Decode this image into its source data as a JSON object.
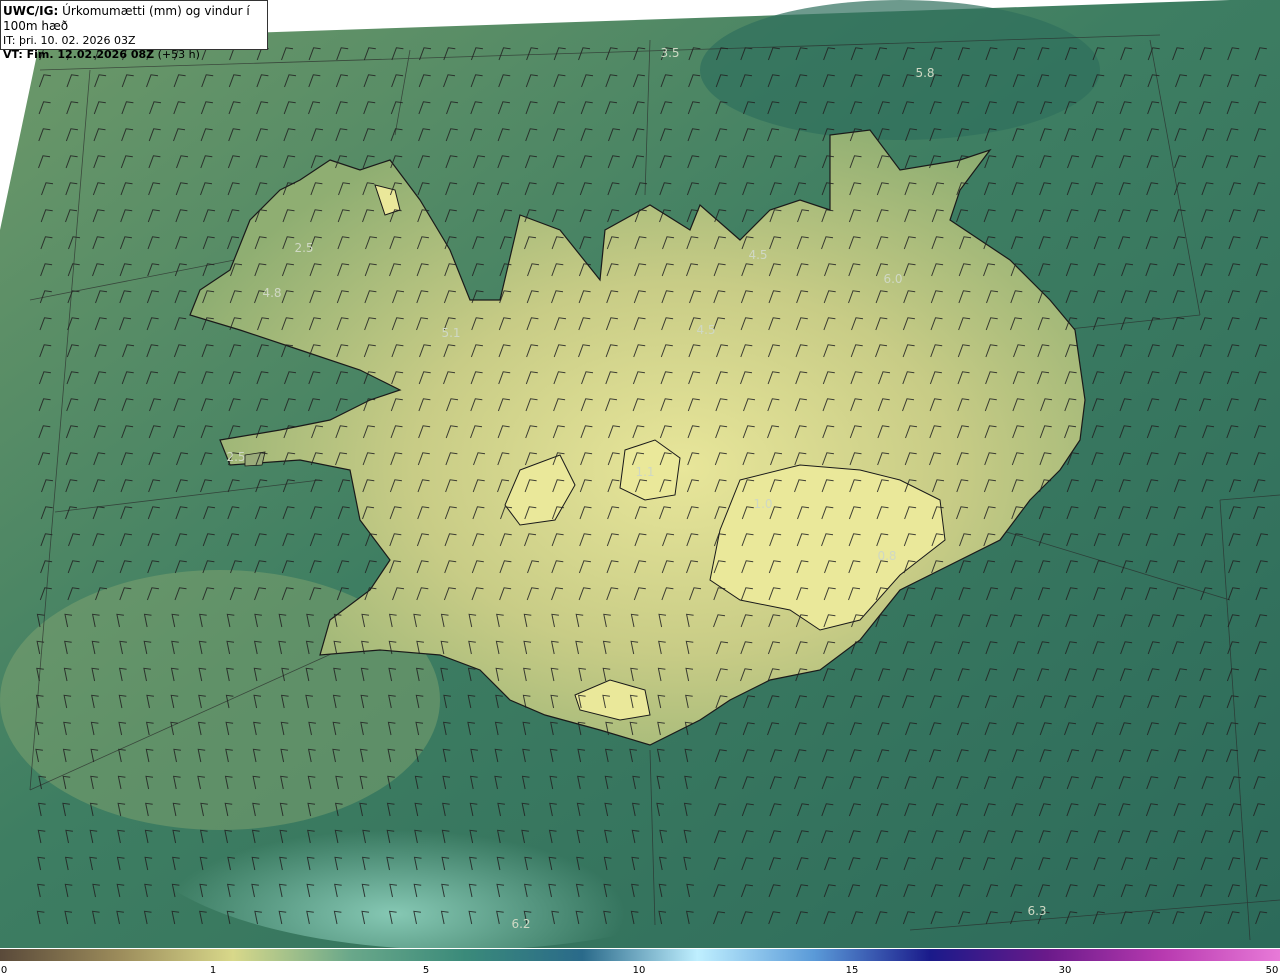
{
  "title": {
    "model": "UWC/IG:",
    "description": "Úrkomumætti (mm) og vindur í 100m hæð",
    "issue_time": "IT: þri. 10. 02. 2026 03Z",
    "valid_prefix": "VT: Fim. 12.02.2026 08Z",
    "valid_suffix": "(+53 h)"
  },
  "map_labels": [
    "3.5",
    "5.8",
    "2.5",
    "4.8",
    "5.1",
    "4.5",
    "4.5",
    "6.0",
    "2.5",
    "1.1",
    "1.0",
    "0.8",
    "6.2",
    "6.3"
  ],
  "colorbar": {
    "ticks": [
      "0",
      "1",
      "5",
      "10",
      "15",
      "30",
      "50"
    ],
    "colors": [
      "#5a4a3a",
      "#9a8a5a",
      "#d8d88a",
      "#6aa88a",
      "#3a8a7a",
      "#2a6a8a",
      "#bfefff",
      "#5a9ad8",
      "#1a1a8a",
      "#6a1a8a",
      "#b83ab0",
      "#e87ad8"
    ]
  },
  "field_colors": {
    "sea_dark": "#2e6e5a",
    "sea_mid": "#4a8a6a",
    "land_low": "#a8b878",
    "land_high": "#e6e496",
    "coast": "#1a1a1a"
  }
}
